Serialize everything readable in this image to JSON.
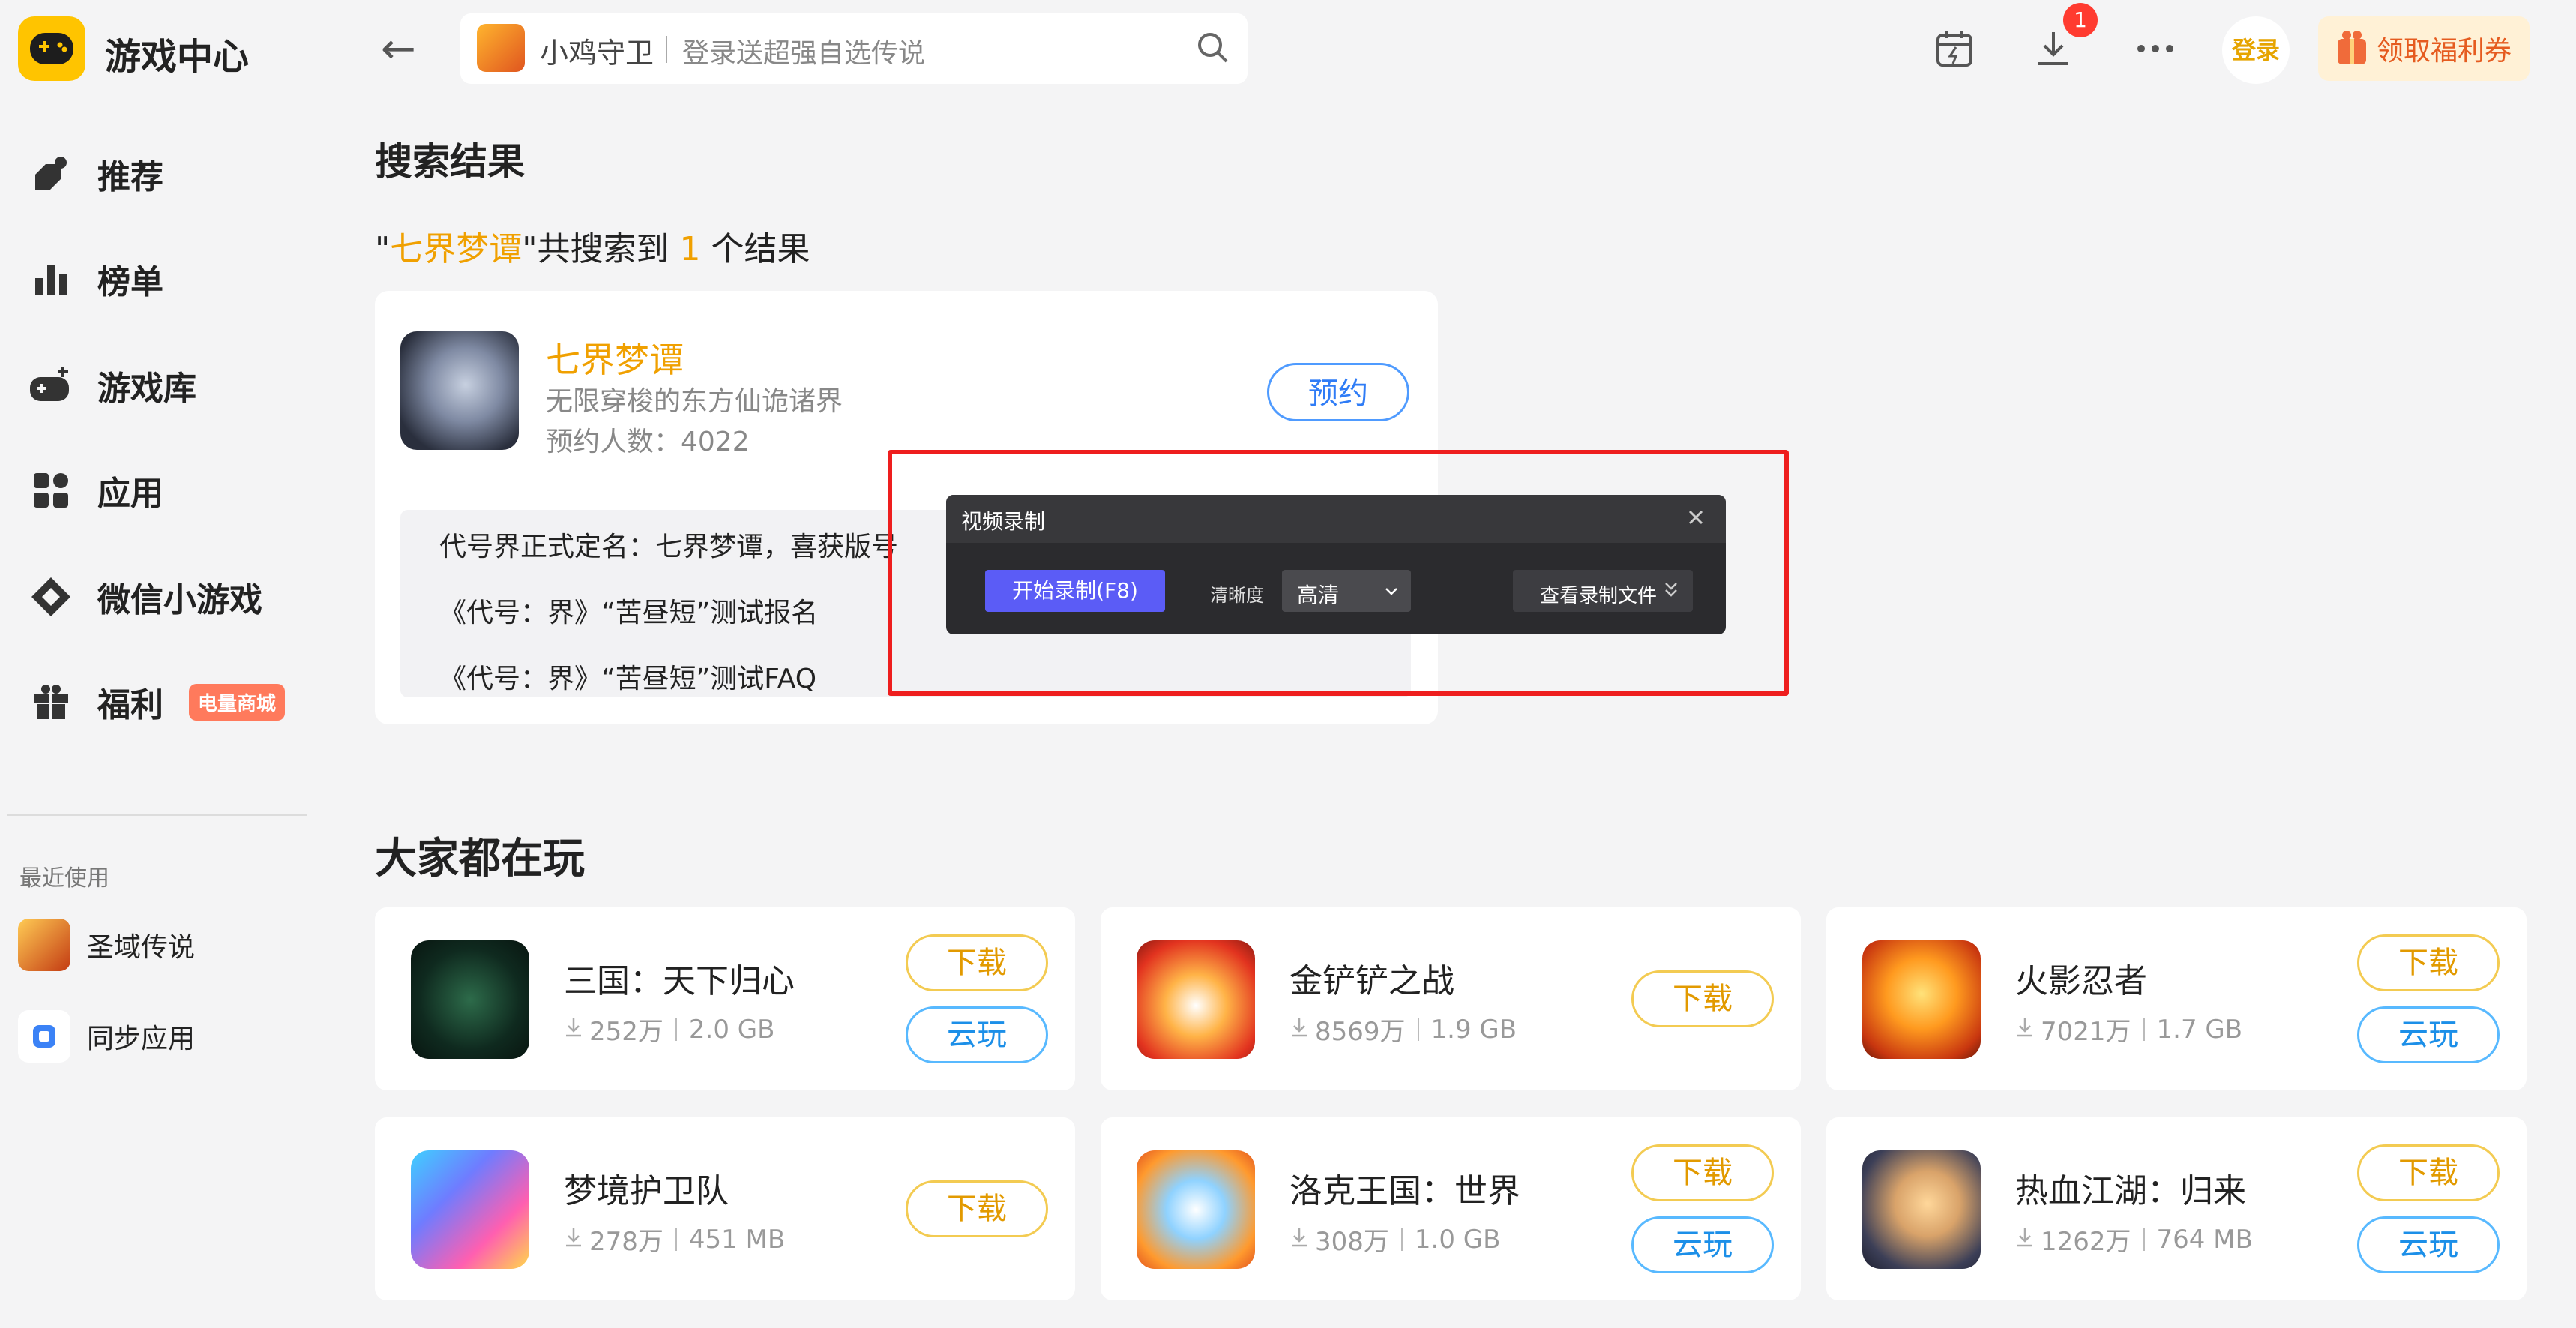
{
  "sidebar": {
    "brand": "游戏中心",
    "items": [
      {
        "label": "推荐",
        "icon": "rocket-icon"
      },
      {
        "label": "榜单",
        "icon": "ranking-icon"
      },
      {
        "label": "游戏库",
        "icon": "gamepad-plus-icon"
      },
      {
        "label": "应用",
        "icon": "apps-grid-icon"
      },
      {
        "label": "微信小游戏",
        "icon": "mini-game-icon"
      },
      {
        "label": "福利",
        "icon": "gift-icon",
        "badge": "电量商城"
      }
    ],
    "recent_title": "最近使用",
    "recent": [
      {
        "label": "圣域传说"
      },
      {
        "label": "同步应用"
      }
    ]
  },
  "topbar": {
    "search_value": "小鸡守卫",
    "search_placeholder": "登录送超强自选传说",
    "download_badge": "1",
    "login_label": "登录",
    "coupon_label": "领取福利券"
  },
  "results": {
    "heading": "搜索结果",
    "query": "七界梦谭",
    "summary_prefix": "\"",
    "summary_mid": "\"共搜索到 ",
    "count": "1",
    "summary_suffix": " 个结果",
    "game": {
      "name": "七界梦谭",
      "desc": "无限穿梭的东方仙诡诸界",
      "reserve_count": "预约人数：4022",
      "reserve_label": "预约"
    },
    "news": [
      "代号界正式定名：七界梦谭，喜获版号",
      "《代号：界》“苦昼短”测试报名",
      "《代号：界》“苦昼短”测试FAQ"
    ]
  },
  "recorder": {
    "title": "视频录制",
    "start_label": "开始录制(F8)",
    "quality_label": "清晰度",
    "quality_value": "高清",
    "files_label": "查看录制文件"
  },
  "popular": {
    "heading": "大家都在玩",
    "games": [
      {
        "name": "三国：天下归心",
        "downloads": "252万",
        "size": "2.0 GB",
        "download_label": "下载",
        "cloud_label": "云玩"
      },
      {
        "name": "金铲铲之战",
        "downloads": "8569万",
        "size": "1.9 GB",
        "download_label": "下载"
      },
      {
        "name": "火影忍者",
        "downloads": "7021万",
        "size": "1.7 GB",
        "download_label": "下载",
        "cloud_label": "云玩"
      },
      {
        "name": "梦境护卫队",
        "downloads": "278万",
        "size": "451 MB",
        "download_label": "下载"
      },
      {
        "name": "洛克王国：世界",
        "downloads": "308万",
        "size": "1.0 GB",
        "download_label": "下载",
        "cloud_label": "云玩"
      },
      {
        "name": "热血江湖：归来",
        "downloads": "1262万",
        "size": "764 MB",
        "download_label": "下载",
        "cloud_label": "云玩"
      }
    ]
  },
  "colors": {
    "accent_orange": "#f0a000",
    "reserve_blue": "#2f7cf6",
    "record_button": "#5b5cf6",
    "highlight_frame": "#ee1e1e"
  }
}
